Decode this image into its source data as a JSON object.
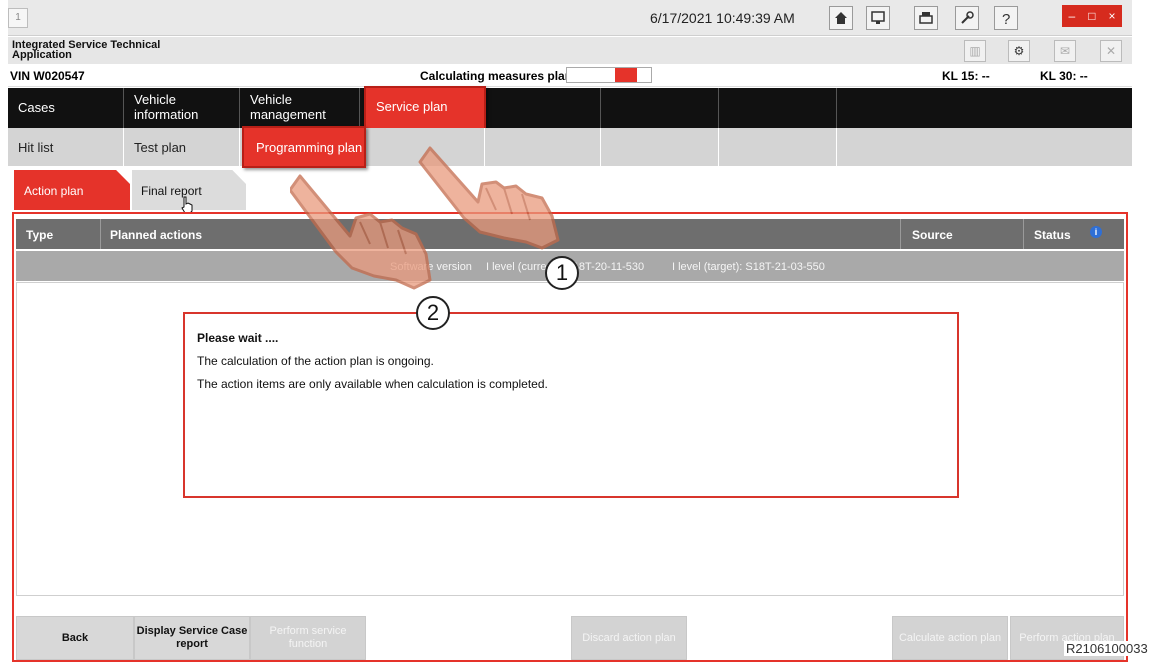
{
  "titlebar": {
    "window_number": "1",
    "datetime": "6/17/2021 10:49:39 AM"
  },
  "app": {
    "title": "Integrated Service Technical Application"
  },
  "vehicle": {
    "vin": "VIN  W020547",
    "calc_label": "Calculating measures plan",
    "calc_progress_fraction": 0.3,
    "kl15": "KL 15:  --",
    "kl30": "KL 30:  --"
  },
  "nav_main": {
    "items": [
      {
        "label": "Cases"
      },
      {
        "label": "Vehicle information"
      },
      {
        "label": "Vehicle management"
      },
      {
        "label": "Service plan"
      }
    ]
  },
  "nav_sub": {
    "items": [
      {
        "label": "Hit list"
      },
      {
        "label": "Test plan"
      },
      {
        "label": "Programming plan"
      }
    ]
  },
  "tabs": {
    "action_plan": "Action plan",
    "final_report": "Final report"
  },
  "table": {
    "headers": {
      "type": "Type",
      "planned_actions": "Planned actions",
      "source": "Source",
      "status": "Status"
    },
    "software_row": {
      "prefix": "Software version",
      "current": "I level (current): S18T-20-11-530",
      "target": "I level (target): S18T-21-03-550"
    }
  },
  "wait": {
    "title": "Please wait ....",
    "line1": "The calculation of the action plan is ongoing.",
    "line2": "The action items are only available when calculation is completed."
  },
  "buttons": {
    "back": "Back",
    "display_report": "Display Service Case report",
    "perform_function": "Perform service function",
    "discard": "Discard action plan",
    "calculate": "Calculate action plan",
    "perform_plan": "Perform action plan"
  },
  "callouts": [
    "1",
    "2"
  ],
  "figure_ref": "R2106100033",
  "colors": {
    "accent_red": "#e5332a",
    "nav_black": "#111111",
    "header_grey": "#6e6e6e"
  }
}
